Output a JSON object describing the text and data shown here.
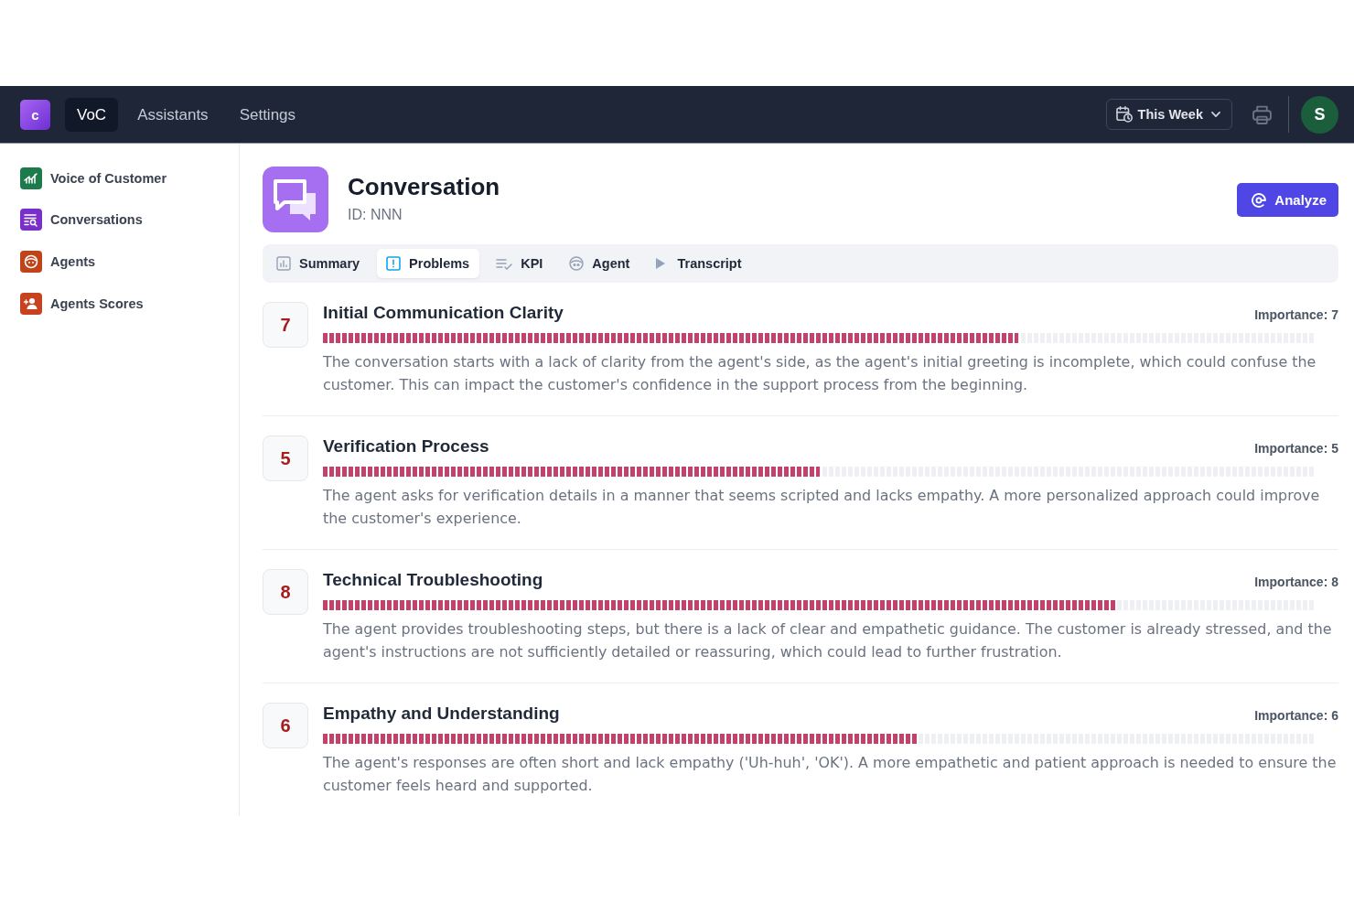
{
  "header": {
    "logo": "c",
    "nav": [
      {
        "label": "VoC",
        "selected": true
      },
      {
        "label": "Assistants",
        "selected": false
      },
      {
        "label": "Settings",
        "selected": false
      }
    ],
    "date_filter": {
      "label": "This Week"
    },
    "avatar": {
      "initial": "S"
    }
  },
  "sidebar": {
    "items": [
      {
        "label": "Voice of Customer",
        "color": "#1d7a4b"
      },
      {
        "label": "Conversations",
        "color": "#7b2fc9"
      },
      {
        "label": "Agents",
        "color": "#c0441a"
      },
      {
        "label": "Agents Scores",
        "color": "#c7421f"
      }
    ]
  },
  "page": {
    "title": "Conversation",
    "id": "ID: NNN",
    "analyze_button": "Analyze"
  },
  "tabs": [
    {
      "label": "Summary",
      "selected": false
    },
    {
      "label": "Problems",
      "selected": true
    },
    {
      "label": "KPI",
      "selected": false
    },
    {
      "label": "Agent",
      "selected": false
    },
    {
      "label": "Transcript",
      "selected": false
    }
  ],
  "problems": [
    {
      "score": "7",
      "title": "Initial Communication Clarity",
      "importance": "Importance: 7",
      "level": 0.7,
      "description": "The conversation starts with a lack of clarity from the agent's side, as the agent's initial greeting is incomplete, which could confuse the customer. This can impact the customer's confidence in the support process from the beginning."
    },
    {
      "score": "5",
      "title": "Verification Process",
      "importance": "Importance: 5",
      "level": 0.5,
      "description": "The agent asks for verification details in a manner that seems scripted and lacks empathy. A more personalized approach could improve the customer's experience."
    },
    {
      "score": "8",
      "title": "Technical Troubleshooting",
      "importance": "Importance: 8",
      "level": 0.8,
      "description": "The agent provides troubleshooting steps, but there is a lack of clear and empathetic guidance. The customer is already stressed, and the agent's instructions are not sufficiently detailed or reassuring, which could lead to further frustration."
    },
    {
      "score": "6",
      "title": "Empathy and Understanding",
      "importance": "Importance: 6",
      "level": 0.6,
      "description": "The agent's responses are often short and lack empathy ('Uh-huh', 'OK'). A more empathetic and patient approach is needed to ensure the customer feels heard and supported."
    }
  ]
}
